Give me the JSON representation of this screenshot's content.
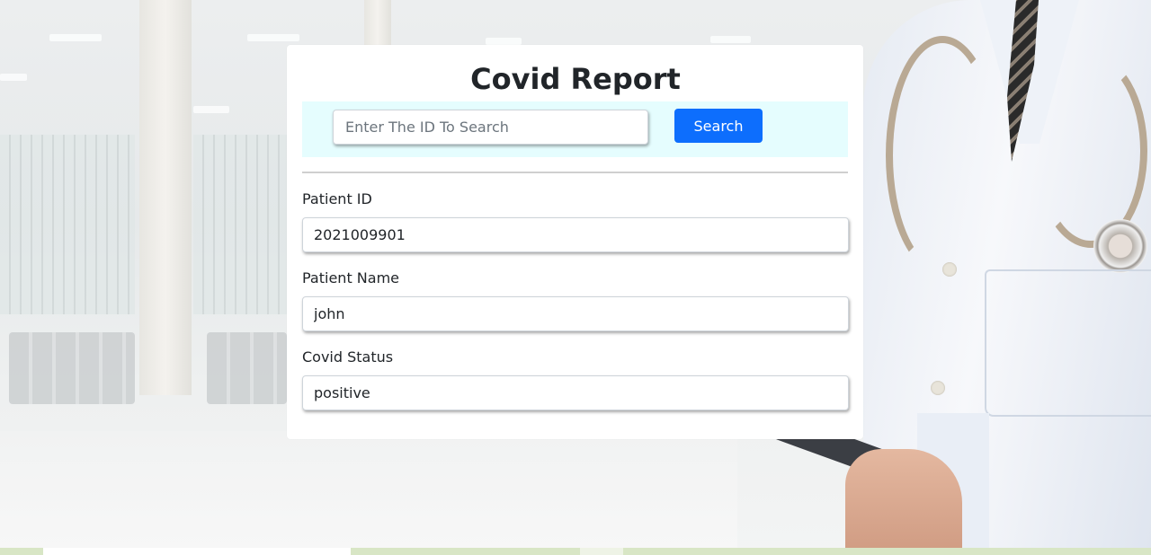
{
  "report": {
    "title": "Covid Report",
    "search": {
      "placeholder": "Enter The ID To Search",
      "value": "",
      "button_label": "Search",
      "button_color": "#0d6efd",
      "band_color": "#e5fdfe"
    },
    "fields": [
      {
        "label": "Patient ID",
        "value": "2021009901"
      },
      {
        "label": "Patient Name",
        "value": "john"
      },
      {
        "label": "Covid Status",
        "value": "positive"
      }
    ]
  }
}
